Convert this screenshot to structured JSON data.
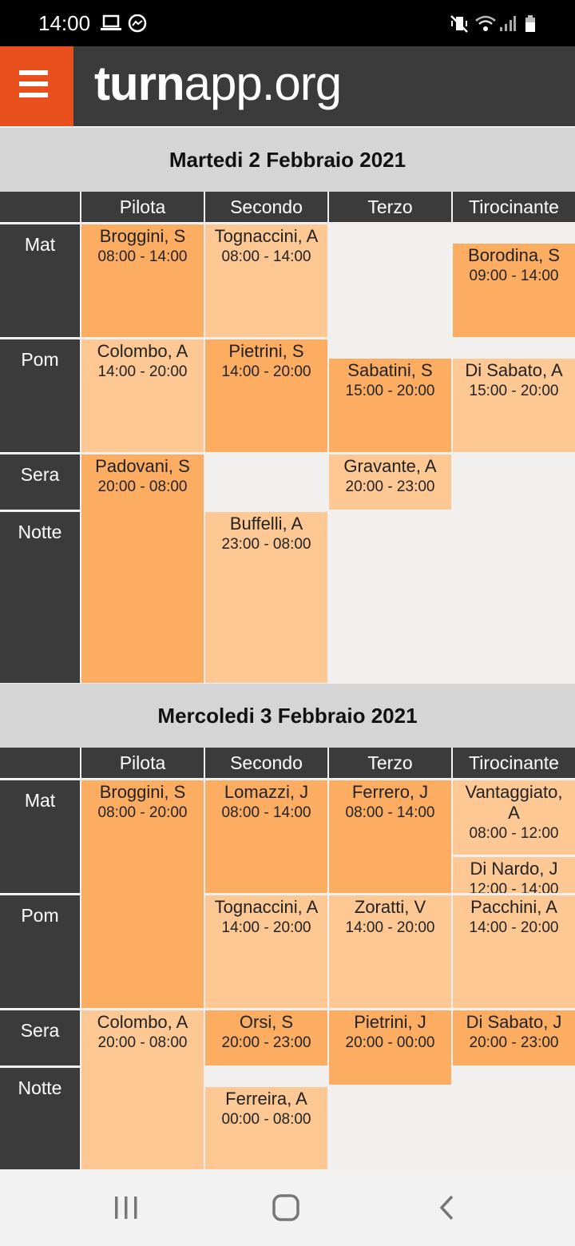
{
  "status": {
    "time": "14:00"
  },
  "header": {
    "brand_bold": "turn",
    "brand_rest": "app.org"
  },
  "columns": [
    "Pilota",
    "Secondo",
    "Terzo",
    "Tirocinante"
  ],
  "rows": [
    "Mat",
    "Pom",
    "Sera",
    "Notte"
  ],
  "days": [
    {
      "date": "Martedi 2 Febbraio 2021",
      "shifts": [
        {
          "name": "Broggini, S",
          "time": "08:00 - 14:00"
        },
        {
          "name": "Tognaccini, A",
          "time": "08:00 - 14:00"
        },
        {
          "name": "Borodina, S",
          "time": "09:00 - 14:00"
        },
        {
          "name": "Colombo, A",
          "time": "14:00 - 20:00"
        },
        {
          "name": "Pietrini, S",
          "time": "14:00 - 20:00"
        },
        {
          "name": "Sabatini, S",
          "time": "15:00 - 20:00"
        },
        {
          "name": "Di Sabato, A",
          "time": "15:00 - 20:00"
        },
        {
          "name": "Padovani, S",
          "time": "20:00 - 08:00"
        },
        {
          "name": "Gravante, A",
          "time": "20:00 - 23:00"
        },
        {
          "name": "Buffelli, A",
          "time": "23:00 - 08:00"
        }
      ]
    },
    {
      "date": "Mercoledi 3 Febbraio 2021",
      "shifts": [
        {
          "name": "Broggini, S",
          "time": "08:00 - 20:00"
        },
        {
          "name": "Lomazzi, J",
          "time": "08:00 - 14:00"
        },
        {
          "name": "Ferrero, J",
          "time": "08:00 - 14:00"
        },
        {
          "name": "Vantaggiato, A",
          "time": "08:00 - 12:00"
        },
        {
          "name": "Di Nardo, J",
          "time": "12:00 - 14:00"
        },
        {
          "name": "Tognaccini, A",
          "time": "14:00 - 20:00"
        },
        {
          "name": "Zoratti, V",
          "time": "14:00 - 20:00"
        },
        {
          "name": "Pacchini, A",
          "time": "14:00 - 20:00"
        },
        {
          "name": "Colombo, A",
          "time": "20:00 - 08:00"
        },
        {
          "name": "Orsi, S",
          "time": "20:00 - 23:00"
        },
        {
          "name": "Pietrini, J",
          "time": "20:00 - 00:00"
        },
        {
          "name": "Di Sabato, J",
          "time": "20:00 - 23:00"
        },
        {
          "name": "Ferreira, A",
          "time": "00:00 - 08:00"
        }
      ]
    }
  ]
}
